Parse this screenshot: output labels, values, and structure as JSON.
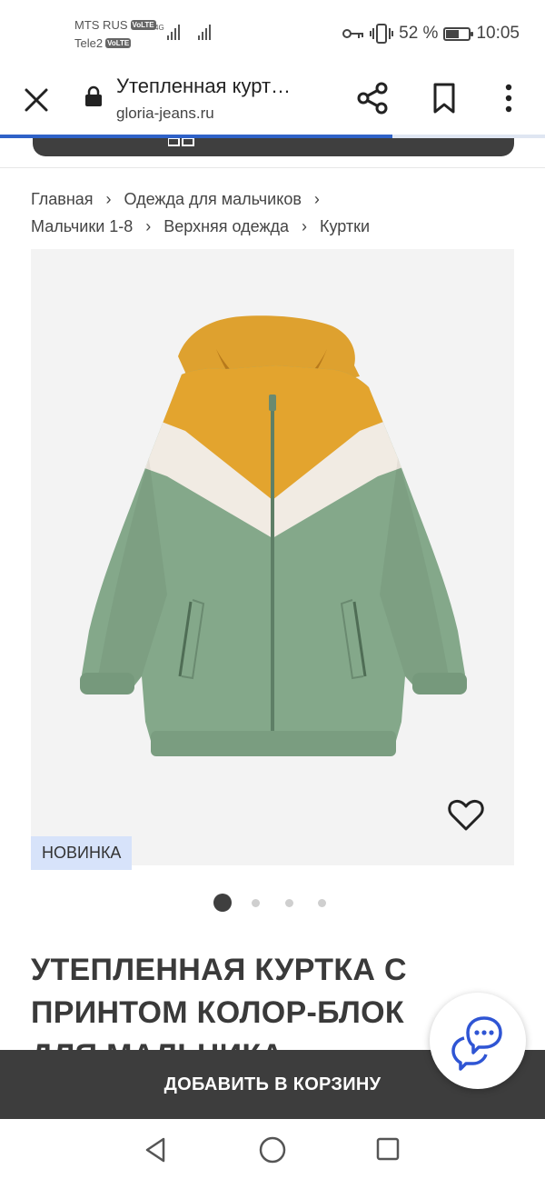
{
  "status_bar": {
    "carrier1": "MTS RUS",
    "carrier2": "Tele2",
    "volte_label": "VoLTE",
    "network_label": "4G",
    "battery_label": "52 %",
    "battery_level": 0.52,
    "time": "10:05"
  },
  "browser": {
    "title": "Утепленная курт…",
    "url": "gloria-jeans.ru",
    "load_progress": 0.72
  },
  "breadcrumb": {
    "items": [
      "Главная",
      "Одежда для мальчиков",
      "Мальчики 1-8",
      "Верхняя одежда",
      "Куртки"
    ],
    "separator": "›"
  },
  "product": {
    "badge": "НОВИНКА",
    "title": "УТЕПЛЕННАЯ КУРТКА С ПРИНТОМ КОЛОР-БЛОК ДЛЯ МАЛЬЧИКА",
    "image_count": 4,
    "active_image": 1
  },
  "cart": {
    "add_label": "ДОБАВИТЬ В КОРЗИНУ"
  },
  "colors": {
    "accent": "#2f62c8",
    "dark": "#3d3d3d",
    "badge_bg": "#d7e3fa",
    "jacket_mustard": "#e3a42e",
    "jacket_cream": "#f2ece4",
    "jacket_sage": "#84a88a"
  },
  "icons": {
    "close": "close-icon",
    "lock": "lock-icon",
    "share": "share-icon",
    "bookmark": "bookmark-icon",
    "menu": "more-vert-icon",
    "favorite": "heart-icon",
    "chat": "chat-icon"
  }
}
